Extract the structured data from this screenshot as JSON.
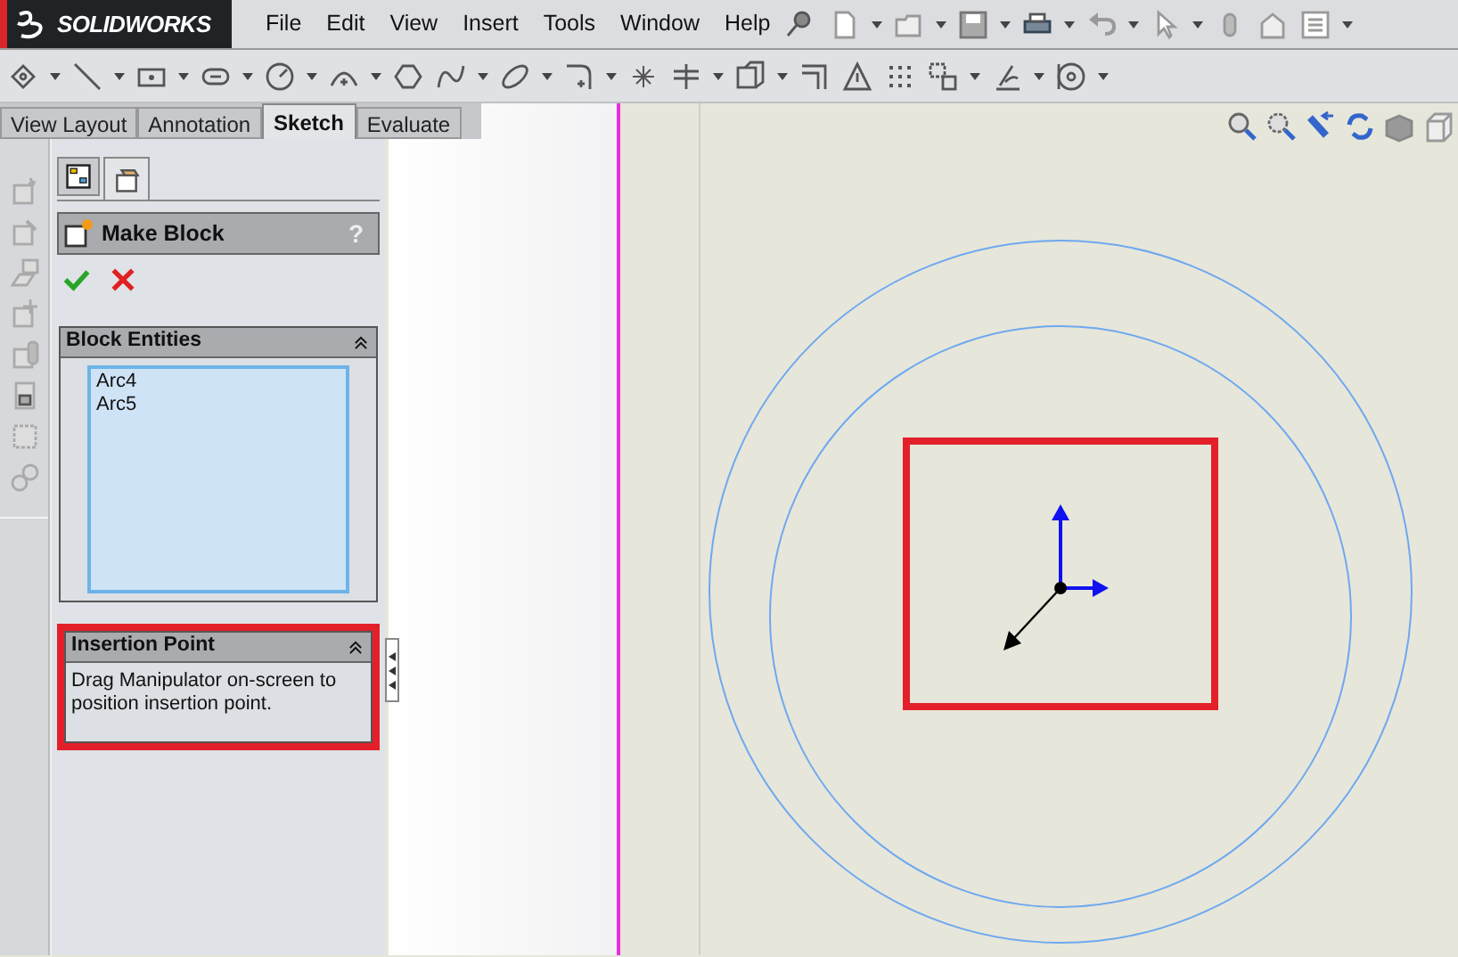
{
  "app": {
    "logo": "SOLIDWORKS"
  },
  "menu": [
    "File",
    "Edit",
    "View",
    "Insert",
    "Tools",
    "Window",
    "Help"
  ],
  "tabs": [
    {
      "label": "View Layout",
      "selected": false
    },
    {
      "label": "Annotation",
      "selected": false
    },
    {
      "label": "Sketch",
      "selected": true
    },
    {
      "label": "Evaluate",
      "selected": false
    }
  ],
  "property_manager": {
    "title": "Make Block",
    "help": "?",
    "sections": [
      {
        "kind": "list",
        "title": "Block Entities",
        "items": [
          "Arc4",
          "Arc5"
        ],
        "highlighted": false
      },
      {
        "kind": "message",
        "title": "Insertion Point",
        "text": "Drag Manipulator on-screen to position insertion point.",
        "highlighted": true
      }
    ]
  }
}
